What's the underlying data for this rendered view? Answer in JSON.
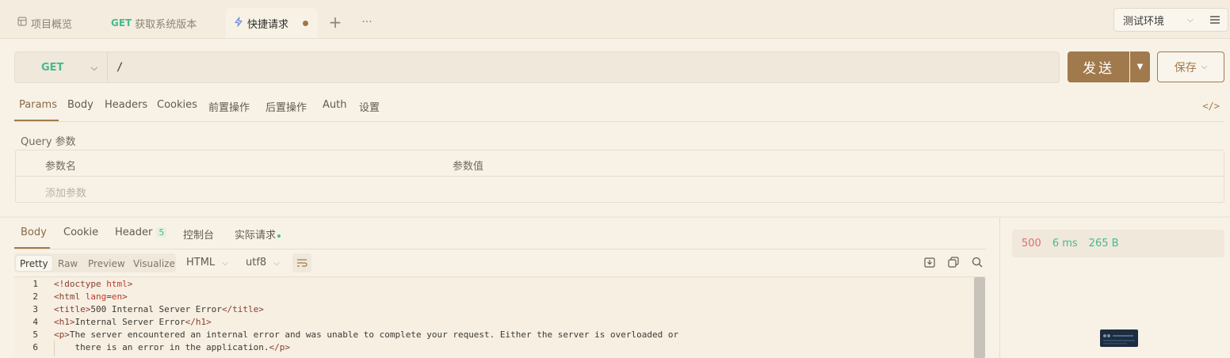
{
  "tabs": [
    {
      "label": "项目概览",
      "icon": "layout-icon"
    },
    {
      "method": "GET",
      "label": "获取系统版本"
    },
    {
      "label": "快捷请求",
      "icon": "lightning-icon",
      "active": true,
      "modified": true
    }
  ],
  "tabbar": {
    "add_label": "+",
    "more_label": "···"
  },
  "environment": {
    "selected": "测试环境"
  },
  "request": {
    "method": "GET",
    "url": "/",
    "send_label": "发送",
    "save_label": "保存",
    "tabs": [
      "Params",
      "Body",
      "Headers",
      "Cookies",
      "前置操作",
      "后置操作",
      "Auth",
      "设置"
    ],
    "active_tab": "Params",
    "code_toggle": "</>"
  },
  "params": {
    "section_label": "Query 参数",
    "col_name": "参数名",
    "col_value": "参数值",
    "add_placeholder": "添加参数"
  },
  "response": {
    "tabs": {
      "body": "Body",
      "cookie": "Cookie",
      "header": "Header",
      "header_count": "5",
      "console": "控制台",
      "actual": "实际请求"
    },
    "view_modes": [
      "Pretty",
      "Raw",
      "Preview",
      "Visualize"
    ],
    "format": "HTML",
    "encoding": "utf8",
    "status": {
      "code": "500",
      "time": "6 ms",
      "size": "265 B"
    },
    "line_numbers": [
      "1",
      "2",
      "3",
      "4",
      "5",
      "6"
    ]
  },
  "colors": {
    "accent": "#a07a4d",
    "get": "#46b98f",
    "error": "#e06c75"
  }
}
